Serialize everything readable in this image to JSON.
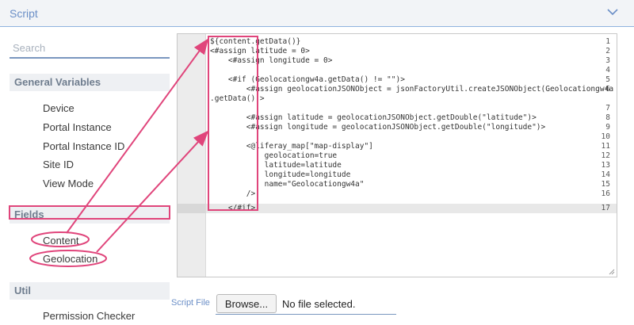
{
  "panel": {
    "title": "Script"
  },
  "sidebar": {
    "search_placeholder": "Search",
    "sections": [
      {
        "label": "General Variables",
        "items": [
          "Device",
          "Portal Instance",
          "Portal Instance ID",
          "Site ID",
          "View Mode"
        ]
      },
      {
        "label": "Fields",
        "items": [
          "Content",
          "Geolocation"
        ]
      },
      {
        "label": "Util",
        "items": [
          "Permission Checker"
        ]
      }
    ]
  },
  "editor": {
    "line_numbers": [
      "1",
      "2",
      "3",
      "4",
      "5",
      "6",
      "7",
      "8",
      "9",
      "10",
      "11",
      "12",
      "13",
      "14",
      "15",
      "16",
      "17"
    ],
    "lines": [
      "${content.getData()}",
      "<#assign latitude = 0>",
      "    <#assign longitude = 0>",
      "",
      "    <#if (Geolocationgw4a.getData() != \"\")>",
      "        <#assign geolocationJSONObject = jsonFactoryUtil.createJSONObject(Geolocationgw4a",
      ".getData())>",
      "",
      "        <#assign latitude = geolocationJSONObject.getDouble(\"latitude\")>",
      "        <#assign longitude = geolocationJSONObject.getDouble(\"longitude\")>",
      "",
      "        <@liferay_map[\"map-display\"]",
      "            geolocation=true",
      "            latitude=latitude",
      "            longitude=longitude",
      "            name=\"Geolocationgw4a\"",
      "        />",
      "    </#if>"
    ]
  },
  "file_input": {
    "label": "Script File",
    "button_label": "Browse...",
    "status": "No file selected."
  },
  "colors": {
    "accent": "#6b8fc7",
    "annotation": "#e0457b"
  }
}
